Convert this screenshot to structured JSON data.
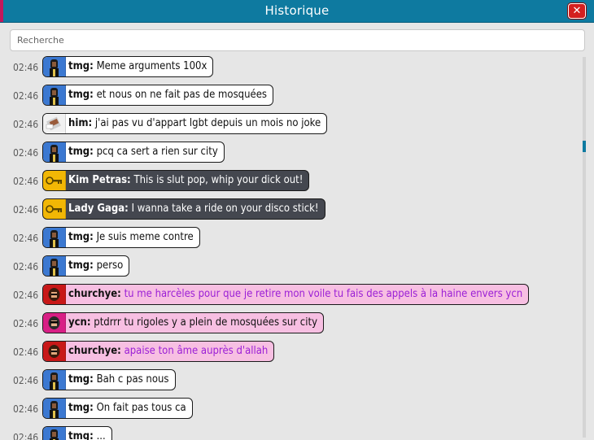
{
  "window": {
    "title": "Historique",
    "close_label": "✕"
  },
  "search": {
    "placeholder": "Recherche",
    "value": ""
  },
  "messages": [
    {
      "time": "02:46",
      "name": "tmg:",
      "text": "Meme arguments 100x",
      "style": "tmg",
      "avatar": "tmg-avatar-icon"
    },
    {
      "time": "02:46",
      "name": "tmg:",
      "text": "et nous on ne fait pas de mosquées",
      "style": "tmg",
      "avatar": "tmg-avatar-icon"
    },
    {
      "time": "02:46",
      "name": "him:",
      "text": "j'ai pas vu d'appart lgbt depuis un mois no joke",
      "style": "him",
      "avatar": "him-avatar-icon"
    },
    {
      "time": "02:46",
      "name": "tmg:",
      "text": "pcq ca sert a rien sur city",
      "style": "tmg",
      "avatar": "tmg-avatar-icon"
    },
    {
      "time": "02:46",
      "name": "Kim Petras:",
      "text": "This is slut pop, whip your dick out!",
      "style": "bot",
      "avatar": "bot-key-icon"
    },
    {
      "time": "02:46",
      "name": "Lady Gaga:",
      "text": "I wanna take a ride on your disco stick!",
      "style": "bot",
      "avatar": "bot-key-icon"
    },
    {
      "time": "02:46",
      "name": "tmg:",
      "text": "Je suis meme contre",
      "style": "tmg",
      "avatar": "tmg-avatar-icon"
    },
    {
      "time": "02:46",
      "name": "tmg:",
      "text": "perso",
      "style": "tmg",
      "avatar": "tmg-avatar-icon"
    },
    {
      "time": "02:46",
      "name": "churchye:",
      "text": "tu me harcèles pour que je retire mon voile tu fais des appels à la haine envers ycn",
      "style": "church",
      "avatar": "churchye-avatar-icon"
    },
    {
      "time": "02:46",
      "name": "ycn:",
      "text": "ptdrrr tu rigoles y a plein de mosquées sur city",
      "style": "ycn",
      "avatar": "ycn-avatar-icon"
    },
    {
      "time": "02:46",
      "name": "churchye:",
      "text": "apaise ton âme auprès d'allah",
      "style": "church",
      "avatar": "churchye-avatar-icon"
    },
    {
      "time": "02:46",
      "name": "tmg:",
      "text": "Bah c pas nous",
      "style": "tmg",
      "avatar": "tmg-avatar-icon"
    },
    {
      "time": "02:46",
      "name": "tmg:",
      "text": "On fait pas tous ca",
      "style": "tmg",
      "avatar": "tmg-avatar-icon"
    },
    {
      "time": "02:46",
      "name": "tmg:",
      "text": "...",
      "style": "tmg",
      "avatar": "tmg-avatar-icon"
    }
  ],
  "colors": {
    "titlebar": "#0e7aa0",
    "close_button": "#d41f1f",
    "bot_bubble": "#44474f",
    "pink_bubble": "#f7bfe2",
    "purple_text": "#9b1fd6",
    "tmg_avatar_bg": "#3b78d1"
  }
}
